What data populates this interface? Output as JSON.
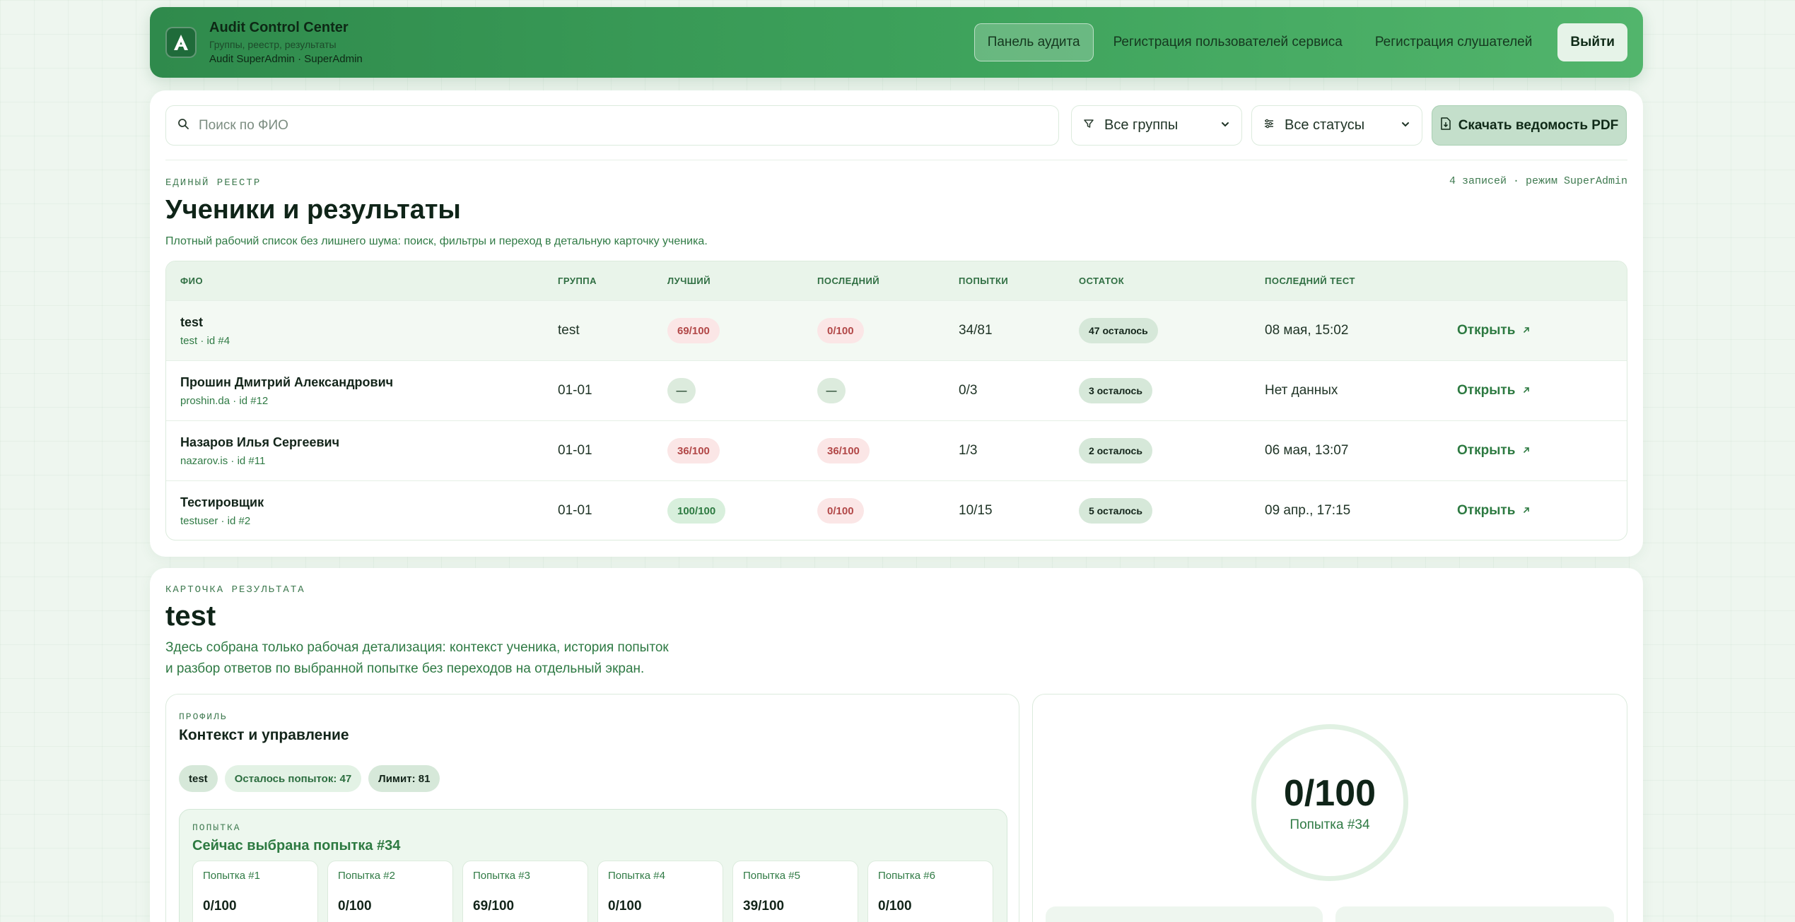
{
  "header": {
    "app_title": "Audit Control Center",
    "subtitle": "Группы, реестр, результаты",
    "user": "Audit SuperAdmin · SuperAdmin",
    "nav": [
      {
        "label": "Панель аудита",
        "active": true
      },
      {
        "label": "Регистрация пользователей сервиса",
        "active": false
      },
      {
        "label": "Регистрация слушателей",
        "active": false
      }
    ],
    "logout": "Выйти"
  },
  "toolbar": {
    "search_placeholder": "Поиск по ФИО",
    "group_filter": "Все группы",
    "status_filter": "Все статусы",
    "download_pdf": "Скачать ведомость PDF"
  },
  "registry": {
    "kicker": "ЕДИНЫЙ РЕЕСТР",
    "count": "4 записей · режим SuperAdmin",
    "title": "Ученики и результаты",
    "description": "Плотный рабочий список без лишнего шума: поиск, фильтры и переход в детальную карточку ученика.",
    "columns": [
      "ФИО",
      "ГРУППА",
      "ЛУЧШИЙ",
      "ПОСЛЕДНИЙ",
      "ПОПЫТКИ",
      "ОСТАТОК",
      "ПОСЛЕДНИЙ ТЕСТ",
      ""
    ],
    "rows": [
      {
        "name": "test",
        "sub": "test · id #4",
        "group": "test",
        "best": "69/100",
        "best_tone": "red",
        "last": "0/100",
        "last_tone": "red",
        "attempts": "34/81",
        "remaining": "47 осталось",
        "last_test": "08 мая, 15:02",
        "action": "Открыть",
        "selected": true
      },
      {
        "name": "Прошин Дмитрий Александрович",
        "sub": "proshin.da · id #12",
        "group": "01-01",
        "best": "—",
        "best_tone": "gray",
        "last": "—",
        "last_tone": "gray",
        "attempts": "0/3",
        "remaining": "3 осталось",
        "last_test": "Нет данных",
        "action": "Открыть",
        "selected": false
      },
      {
        "name": "Назаров Илья Сергеевич",
        "sub": "nazarov.is · id #11",
        "group": "01-01",
        "best": "36/100",
        "best_tone": "red",
        "last": "36/100",
        "last_tone": "red",
        "attempts": "1/3",
        "remaining": "2 осталось",
        "last_test": "06 мая, 13:07",
        "action": "Открыть",
        "selected": false
      },
      {
        "name": "Тестировщик",
        "sub": "testuser · id #2",
        "group": "01-01",
        "best": "100/100",
        "best_tone": "green",
        "last": "0/100",
        "last_tone": "red",
        "attempts": "10/15",
        "remaining": "5 осталось",
        "last_test": "09 апр., 17:15",
        "action": "Открыть",
        "selected": false
      }
    ]
  },
  "result_card": {
    "kicker": "КАРТОЧКА РЕЗУЛЬТАТА",
    "title": "test",
    "description_line1": "Здесь собрана только рабочая детализация: контекст ученика, история попыток",
    "description_line2": "и разбор ответов по выбранной попытке без переходов на отдельный экран.",
    "profile": {
      "kicker": "ПРОФИЛЬ",
      "title": "Контекст и управление",
      "chips": [
        "test",
        "Осталось попыток: 47",
        "Лимит: 81"
      ]
    },
    "attempt": {
      "kicker": "ПОПЫТКА",
      "title": "Сейчас выбрана попытка #34",
      "items": [
        {
          "label": "Попытка #1",
          "score": "0/100"
        },
        {
          "label": "Попытка #2",
          "score": "0/100"
        },
        {
          "label": "Попытка #3",
          "score": "69/100"
        },
        {
          "label": "Попытка #4",
          "score": "0/100"
        },
        {
          "label": "Попытка #5",
          "score": "39/100"
        },
        {
          "label": "Попытка #6",
          "score": "0/100"
        }
      ]
    },
    "score": {
      "value": "0/100",
      "label": "Попытка #34"
    }
  }
}
